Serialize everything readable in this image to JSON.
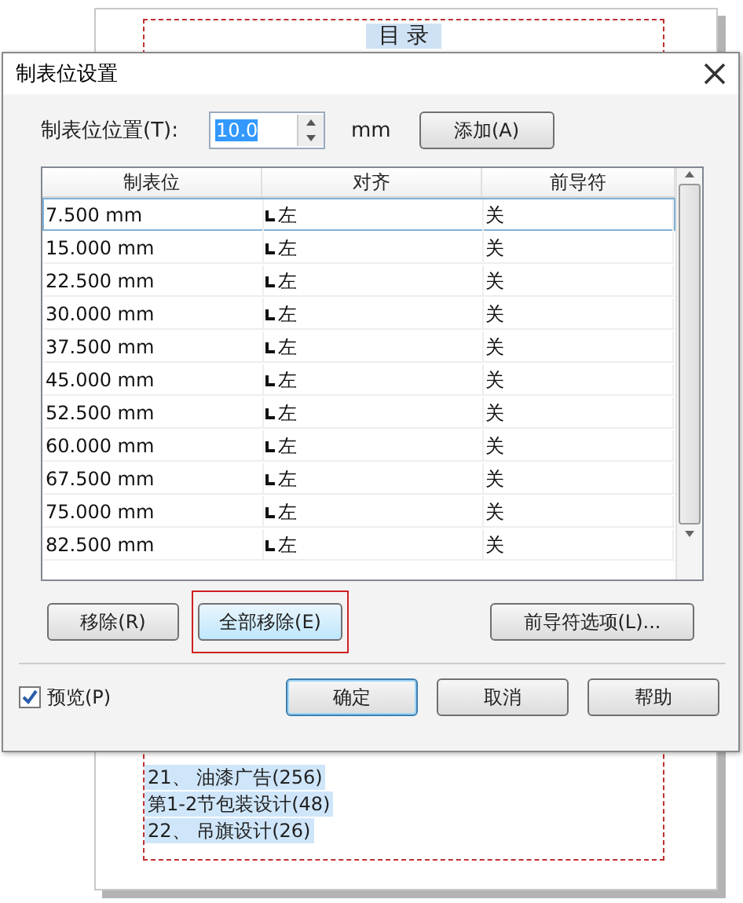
{
  "document": {
    "heading": "目 录",
    "lines": [
      "21、 油漆广告(256)",
      "第1-2节包装设计(48)",
      "22、 吊旗设计(26)"
    ]
  },
  "dialog": {
    "title": "制表位设置",
    "position": {
      "label": "制表位位置(T):",
      "value": "10.0",
      "unit": "mm",
      "add_button": "添加(A)"
    },
    "table": {
      "columns": [
        "制表位",
        "对齐",
        "前导符"
      ],
      "rows": [
        {
          "position": "7.500 mm",
          "alignment": "左",
          "leader": "关",
          "selected": true
        },
        {
          "position": "15.000 mm",
          "alignment": "左",
          "leader": "关",
          "selected": false
        },
        {
          "position": "22.500 mm",
          "alignment": "左",
          "leader": "关",
          "selected": false
        },
        {
          "position": "30.000 mm",
          "alignment": "左",
          "leader": "关",
          "selected": false
        },
        {
          "position": "37.500 mm",
          "alignment": "左",
          "leader": "关",
          "selected": false
        },
        {
          "position": "45.000 mm",
          "alignment": "左",
          "leader": "关",
          "selected": false
        },
        {
          "position": "52.500 mm",
          "alignment": "左",
          "leader": "关",
          "selected": false
        },
        {
          "position": "60.000 mm",
          "alignment": "左",
          "leader": "关",
          "selected": false
        },
        {
          "position": "67.500 mm",
          "alignment": "左",
          "leader": "关",
          "selected": false
        },
        {
          "position": "75.000 mm",
          "alignment": "左",
          "leader": "关",
          "selected": false
        },
        {
          "position": "82.500 mm",
          "alignment": "左",
          "leader": "关",
          "selected": false
        }
      ]
    },
    "actions": [
      {
        "label": "移除(R)",
        "highlighted": false
      },
      {
        "label": "全部移除(E)",
        "highlighted": true
      },
      {
        "label": "前导符选项(L)...",
        "highlighted": false
      }
    ],
    "preview": {
      "label": "预览(P)",
      "checked": true
    },
    "footer_buttons": [
      {
        "label": "确定",
        "default": true
      },
      {
        "label": "取消",
        "default": false
      },
      {
        "label": "帮助",
        "default": false
      }
    ]
  }
}
